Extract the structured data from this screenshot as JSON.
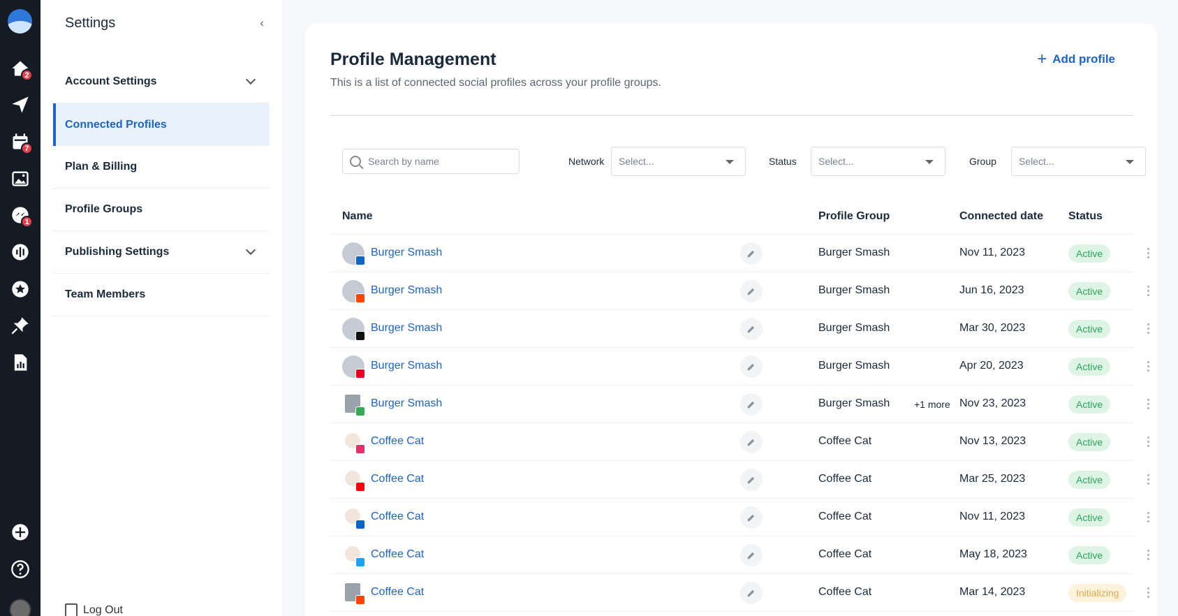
{
  "rail": {
    "badges": {
      "home": "2",
      "calendar": "7",
      "inbox": "1"
    }
  },
  "settings": {
    "title": "Settings",
    "items": [
      {
        "label": "Account Settings",
        "has_chevron": true
      },
      {
        "label": "Connected Profiles",
        "active": true
      },
      {
        "label": "Plan & Billing"
      },
      {
        "label": "Profile Groups"
      },
      {
        "label": "Publishing Settings",
        "has_chevron": true
      },
      {
        "label": "Team Members"
      }
    ],
    "logout": "Log Out"
  },
  "main": {
    "title": "Profile Management",
    "subtitle": "This is a list of connected social profiles across your profile groups.",
    "add_label": "Add profile"
  },
  "filters": {
    "search_placeholder": "Search by name",
    "network_label": "Network",
    "network_value": "Select...",
    "status_label": "Status",
    "status_value": "Select...",
    "group_label": "Group",
    "group_value": "Select..."
  },
  "table": {
    "headers": {
      "name": "Name",
      "group": "Profile Group",
      "date": "Connected date",
      "status": "Status"
    },
    "rows": [
      {
        "name": "Burger Smash",
        "network": "linkedin-icon",
        "network_color": "#0a66c2",
        "group": "Burger Smash",
        "more": "",
        "date": "Nov 11, 2023",
        "status": "Active"
      },
      {
        "name": "Burger Smash",
        "network": "reddit-icon",
        "network_color": "#ff4500",
        "group": "Burger Smash",
        "more": "",
        "date": "Jun 16, 2023",
        "status": "Active"
      },
      {
        "name": "Burger Smash",
        "network": "tiktok-icon",
        "network_color": "#111111",
        "group": "Burger Smash",
        "more": "",
        "date": "Mar 30, 2023",
        "status": "Active"
      },
      {
        "name": "Burger Smash",
        "network": "pinterest-icon",
        "network_color": "#e60023",
        "group": "Burger Smash",
        "more": "",
        "date": "Apr 20, 2023",
        "status": "Active"
      },
      {
        "name": "Burger Smash",
        "network": "google-business-icon",
        "network_color": "#34a853",
        "group": "Burger Smash",
        "more": "+1 more",
        "date": "Nov 23, 2023",
        "status": "Active"
      },
      {
        "name": "Coffee Cat",
        "network": "instagram-icon",
        "network_color": "#e1306c",
        "group": "Coffee Cat",
        "more": "",
        "date": "Nov 13, 2023",
        "status": "Active"
      },
      {
        "name": "Coffee Cat",
        "network": "youtube-icon",
        "network_color": "#ff0000",
        "group": "Coffee Cat",
        "more": "",
        "date": "Mar 25, 2023",
        "status": "Active"
      },
      {
        "name": "Coffee Cat",
        "network": "linkedin-icon",
        "network_color": "#0a66c2",
        "group": "Coffee Cat",
        "more": "",
        "date": "Nov 11, 2023",
        "status": "Active"
      },
      {
        "name": "Coffee Cat",
        "network": "twitter-icon",
        "network_color": "#1da1f2",
        "group": "Coffee Cat",
        "more": "",
        "date": "May 18, 2023",
        "status": "Active"
      },
      {
        "name": "Coffee Cat",
        "network": "google-business-icon",
        "network_color": "#ff4500",
        "group": "Coffee Cat",
        "more": "",
        "date": "Mar 14, 2023",
        "status": "Initializing"
      }
    ]
  }
}
